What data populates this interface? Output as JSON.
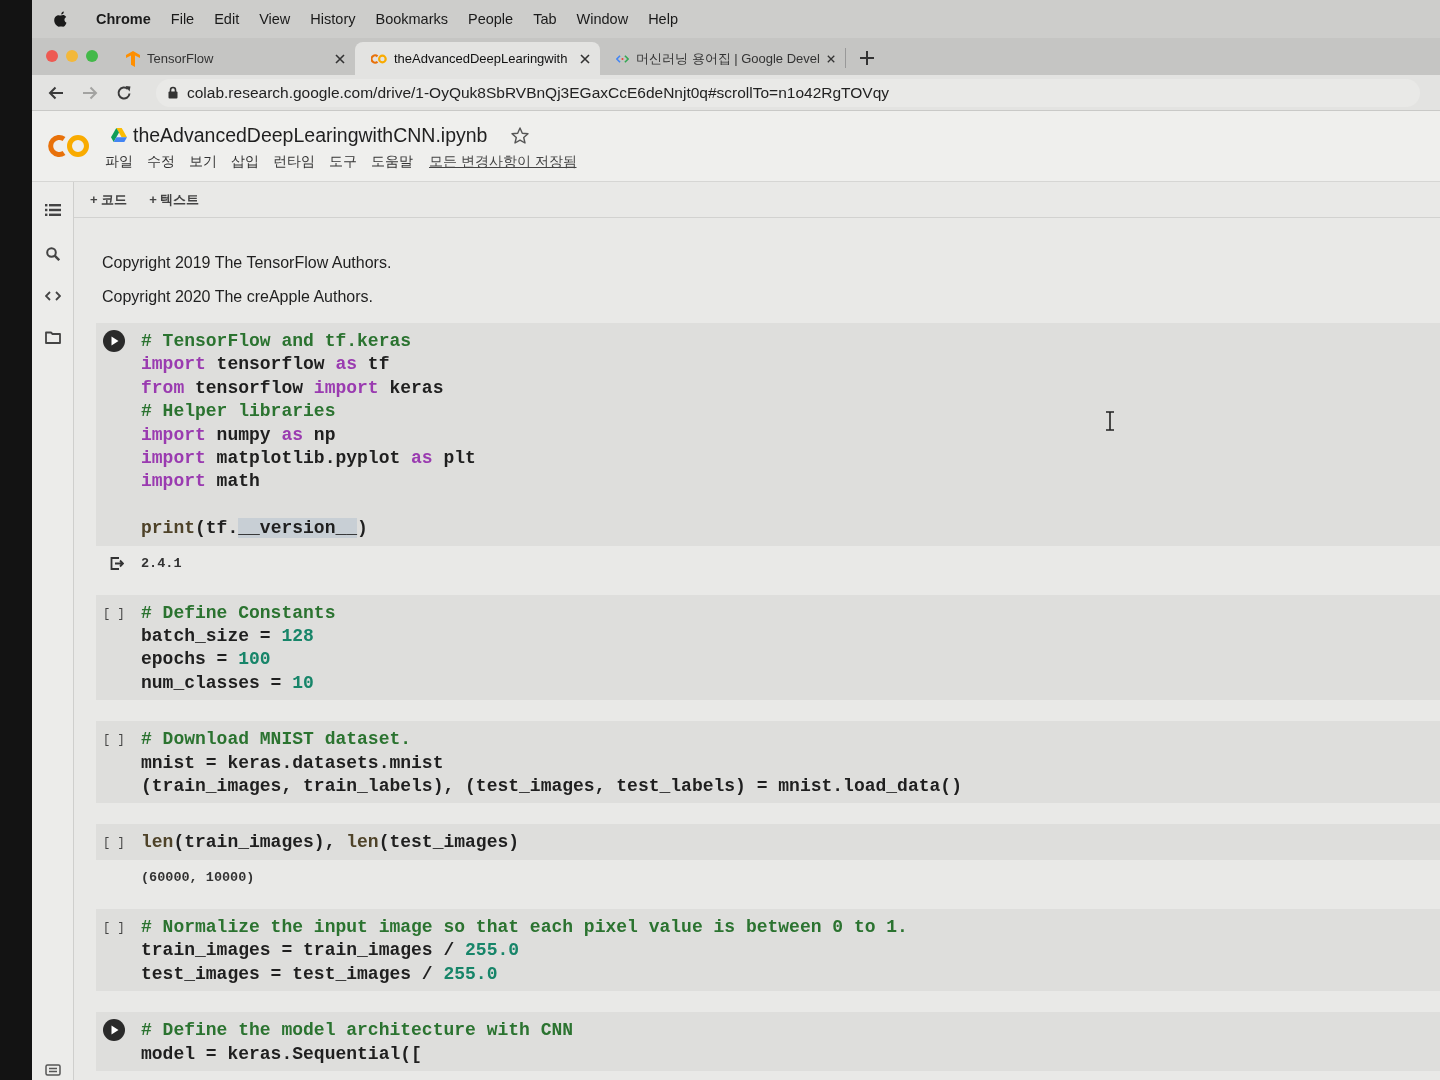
{
  "menubar": {
    "app": "Chrome",
    "items": [
      "File",
      "Edit",
      "View",
      "History",
      "Bookmarks",
      "People",
      "Tab",
      "Window",
      "Help"
    ]
  },
  "tabs": [
    {
      "kind": "tensorflow",
      "title": "TensorFlow",
      "selected": false
    },
    {
      "kind": "colab",
      "title": "theAdvancedDeepLearingwith",
      "selected": true
    },
    {
      "kind": "developers",
      "title": "머신러닝 용어집 | Google Devel",
      "selected": false
    }
  ],
  "navigation": {
    "back": {
      "disabled": false
    },
    "forward": {
      "disabled": true
    },
    "url": "colab.research.google.com/drive/1-OyQuk8SbRVBnQj3EGaxCcE6deNnjt0q#scrollTo=n1o42RgTOVqy"
  },
  "notebook": {
    "title": "theAdvancedDeepLearingwithCNN.ipynb",
    "menu": [
      "파일",
      "수정",
      "보기",
      "삽입",
      "런타임",
      "도구",
      "도움말"
    ],
    "save_status": "모든 변경사항이 저장됨",
    "toolbar": [
      "+ 코드",
      "+ 텍스트"
    ]
  },
  "cells": [
    {
      "kind": "text",
      "paragraphs": [
        "Copyright 2019 The TensorFlow Authors.",
        "Copyright 2020 The creApple Authors."
      ]
    },
    {
      "kind": "code",
      "focused": true,
      "blocks": [
        {
          "lines": [
            [
              {
                "kind": "comment",
                "text": "# TensorFlow and tf.keras"
              }
            ],
            [
              {
                "kind": "keyword",
                "text": "import"
              },
              {
                "kind": "plain",
                "text": " tensorflow "
              },
              {
                "kind": "keyword",
                "text": "as"
              },
              {
                "kind": "plain",
                "text": " tf"
              }
            ],
            [
              {
                "kind": "keyword",
                "text": "from"
              },
              {
                "kind": "plain",
                "text": " tensorflow "
              },
              {
                "kind": "keyword",
                "text": "import"
              },
              {
                "kind": "plain",
                "text": " keras"
              }
            ],
            [
              {
                "kind": "comment",
                "text": "# Helper libraries"
              }
            ],
            [
              {
                "kind": "keyword",
                "text": "import"
              },
              {
                "kind": "plain",
                "text": " numpy "
              },
              {
                "kind": "keyword",
                "text": "as"
              },
              {
                "kind": "plain",
                "text": " np"
              }
            ],
            [
              {
                "kind": "keyword",
                "text": "import"
              },
              {
                "kind": "plain",
                "text": " matplotlib.pyplot "
              },
              {
                "kind": "keyword",
                "text": "as"
              },
              {
                "kind": "plain",
                "text": " plt"
              }
            ],
            [
              {
                "kind": "keyword",
                "text": "import"
              },
              {
                "kind": "plain",
                "text": " math"
              }
            ]
          ]
        },
        {
          "lines": [
            [
              {
                "kind": "builtin",
                "text": "print"
              },
              {
                "kind": "plain",
                "text": "(tf."
              },
              {
                "kind": "highlight",
                "text": "__version__"
              },
              {
                "kind": "plain",
                "text": ")"
              }
            ]
          ]
        }
      ],
      "output": {
        "text": "2.4.1"
      }
    },
    {
      "kind": "code",
      "focused": false,
      "prompt": "[ ]",
      "blocks": [
        {
          "lines": [
            [
              {
                "kind": "comment",
                "text": "# Define Constants"
              }
            ],
            [
              {
                "kind": "plain",
                "text": "batch_size = "
              },
              {
                "kind": "number",
                "text": "128"
              }
            ],
            [
              {
                "kind": "plain",
                "text": "epochs = "
              },
              {
                "kind": "number",
                "text": "100"
              }
            ],
            [
              {
                "kind": "plain",
                "text": "num_classes = "
              },
              {
                "kind": "number",
                "text": "10"
              }
            ]
          ]
        }
      ]
    },
    {
      "kind": "code",
      "focused": false,
      "prompt": "[ ]",
      "blocks": [
        {
          "lines": [
            [
              {
                "kind": "comment",
                "text": "# Download MNIST dataset."
              }
            ],
            [
              {
                "kind": "plain",
                "text": "mnist = keras.datasets.mnist"
              }
            ],
            [
              {
                "kind": "plain",
                "text": "(train_images, train_labels), (test_images, test_labels) = mnist.load_data()"
              }
            ]
          ]
        }
      ]
    },
    {
      "kind": "code",
      "focused": false,
      "prompt": "[ ]",
      "blocks": [
        {
          "lines": [
            [
              {
                "kind": "builtin",
                "text": "len"
              },
              {
                "kind": "plain",
                "text": "(train_images), "
              },
              {
                "kind": "builtin",
                "text": "len"
              },
              {
                "kind": "plain",
                "text": "(test_images)"
              }
            ]
          ]
        }
      ],
      "output": {
        "text": "(60000, 10000)"
      }
    },
    {
      "kind": "code",
      "focused": false,
      "prompt": "[ ]",
      "blocks": [
        {
          "lines": [
            [
              {
                "kind": "comment",
                "text": "# Normalize the input image so that each pixel value is between 0 to 1."
              }
            ],
            [
              {
                "kind": "plain",
                "text": "train_images = train_images / "
              },
              {
                "kind": "number",
                "text": "255.0"
              }
            ],
            [
              {
                "kind": "plain",
                "text": "test_images = test_images / "
              },
              {
                "kind": "number",
                "text": "255.0"
              }
            ]
          ]
        }
      ]
    },
    {
      "kind": "code",
      "focused": true,
      "blocks": [
        {
          "lines": [
            [
              {
                "kind": "comment",
                "text": "# Define the model architecture with CNN"
              }
            ],
            [
              {
                "kind": "plain",
                "text": "model = keras.Sequential(["
              }
            ]
          ]
        }
      ]
    }
  ]
}
